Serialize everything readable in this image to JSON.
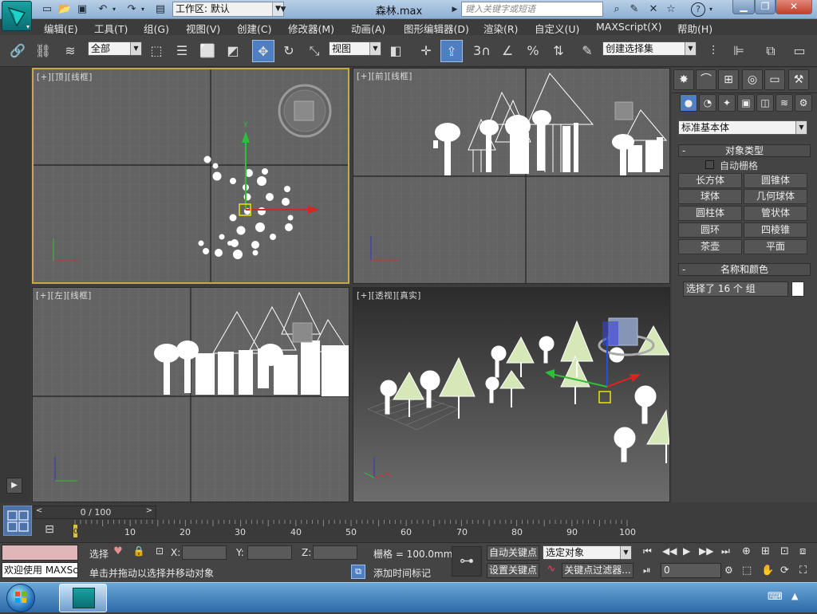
{
  "title_bar": {
    "workspace_label": "工作区: 默认",
    "document_title": "森林.max",
    "search_placeholder": "键入关键字或短语"
  },
  "menu": [
    "编辑(E)",
    "工具(T)",
    "组(G)",
    "视图(V)",
    "创建(C)",
    "修改器(M)",
    "动画(A)",
    "图形编辑器(D)",
    "渲染(R)",
    "自定义(U)",
    "MAXScript(X)",
    "帮助(H)"
  ],
  "toolbar": {
    "filter_dropdown": "全部",
    "ref_coord_dropdown": "视图",
    "snap_label": "3",
    "named_selection": "创建选择集"
  },
  "viewports": {
    "top": "[+][顶][线框]",
    "front": "[+][前][线框]",
    "left": "[+][左][线框]",
    "perspective": "[+][透视][真实]"
  },
  "command_panel": {
    "category_dropdown": "标准基本体",
    "object_type_title": "对象类型",
    "autogrid_label": "自动栅格",
    "buttons": [
      "长方体",
      "圆锥体",
      "球体",
      "几何球体",
      "圆柱体",
      "管状体",
      "圆环",
      "四棱锥",
      "茶壶",
      "平面"
    ],
    "name_color_title": "名称和颜色",
    "name_field": "选择了 16 个 组",
    "swatch_color": "#ffffff"
  },
  "timeline": {
    "frame_display": "0 / 100",
    "ticks": [
      "10",
      "20",
      "30",
      "40",
      "50",
      "60",
      "70",
      "80",
      "90",
      "100"
    ],
    "track_start": "0"
  },
  "status": {
    "welcome": "欢迎使用 MAXSc",
    "selection_prefix": "选择",
    "x_label": "X:",
    "y_label": "Y:",
    "z_label": "Z:",
    "grid_label": "栅格 = 100.0mm",
    "hint": "单击并拖动以选择并移动对象",
    "add_time_tag": "添加时间标记",
    "auto_key": "自动关键点",
    "key_mode_dropdown": "选定对象",
    "set_key": "设置关键点",
    "key_filters": "关键点过滤器...",
    "current_frame": "0"
  }
}
